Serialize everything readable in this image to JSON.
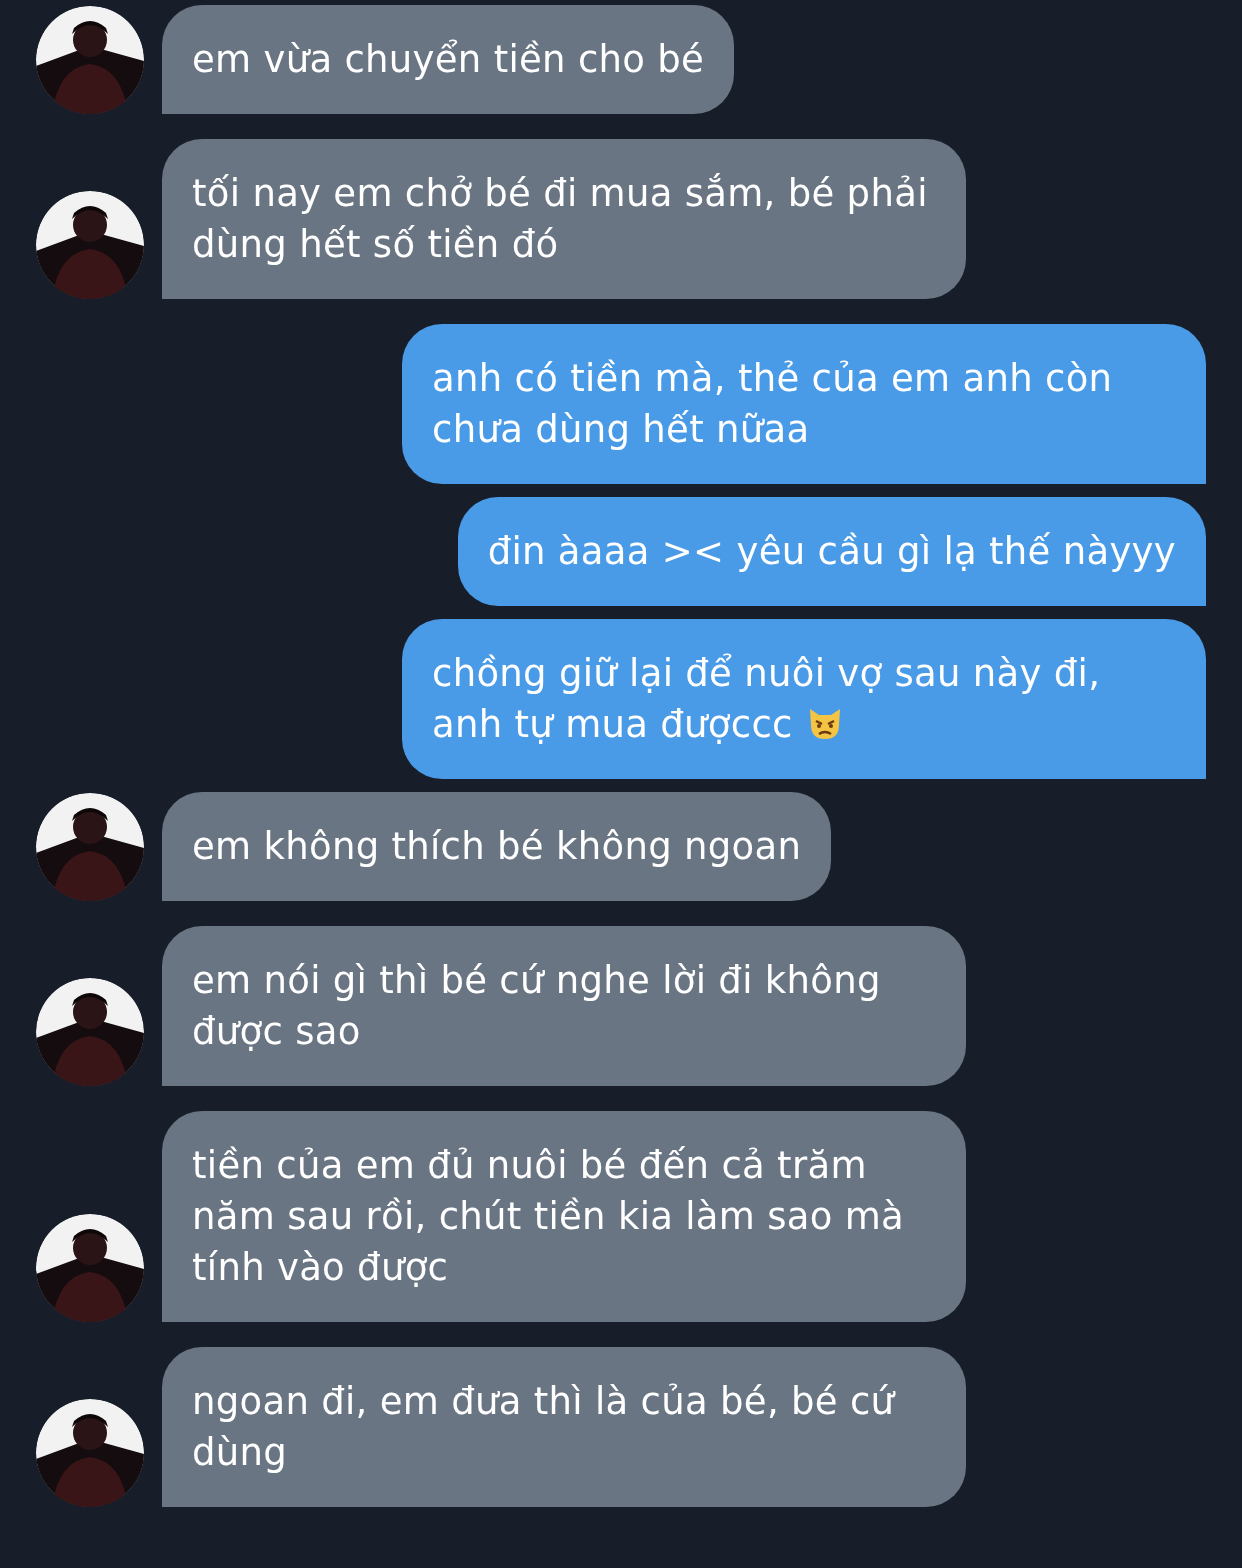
{
  "messages": [
    {
      "kind": "incoming",
      "text": "em vừa chuyển tiền cho bé"
    },
    {
      "kind": "incoming",
      "text": "tối nay em chở bé đi mua sắm, bé phải dùng hết số tiền đó"
    },
    {
      "kind": "outgoing",
      "text": "anh có tiền mà, thẻ của em anh còn chưa dùng hết nữaa"
    },
    {
      "kind": "outgoing",
      "text": "đin àaaa >< yêu cầu gì lạ thế nàyyy"
    },
    {
      "kind": "outgoing",
      "text": "chồng giữ lại để nuôi vợ sau này đi, anh tự mua đượccc",
      "has_emoji": true
    },
    {
      "kind": "incoming",
      "text": "em không thích bé không ngoan"
    },
    {
      "kind": "incoming",
      "text": "em nói gì thì bé cứ nghe lời đi không được sao"
    },
    {
      "kind": "incoming",
      "text": "tiền của em đủ nuôi bé đến cả trăm năm sau rồi, chút tiền kia làm sao mà tính vào được"
    },
    {
      "kind": "incoming",
      "text": "ngoan đi, em đưa thì là của bé, bé cứ dùng"
    }
  ]
}
